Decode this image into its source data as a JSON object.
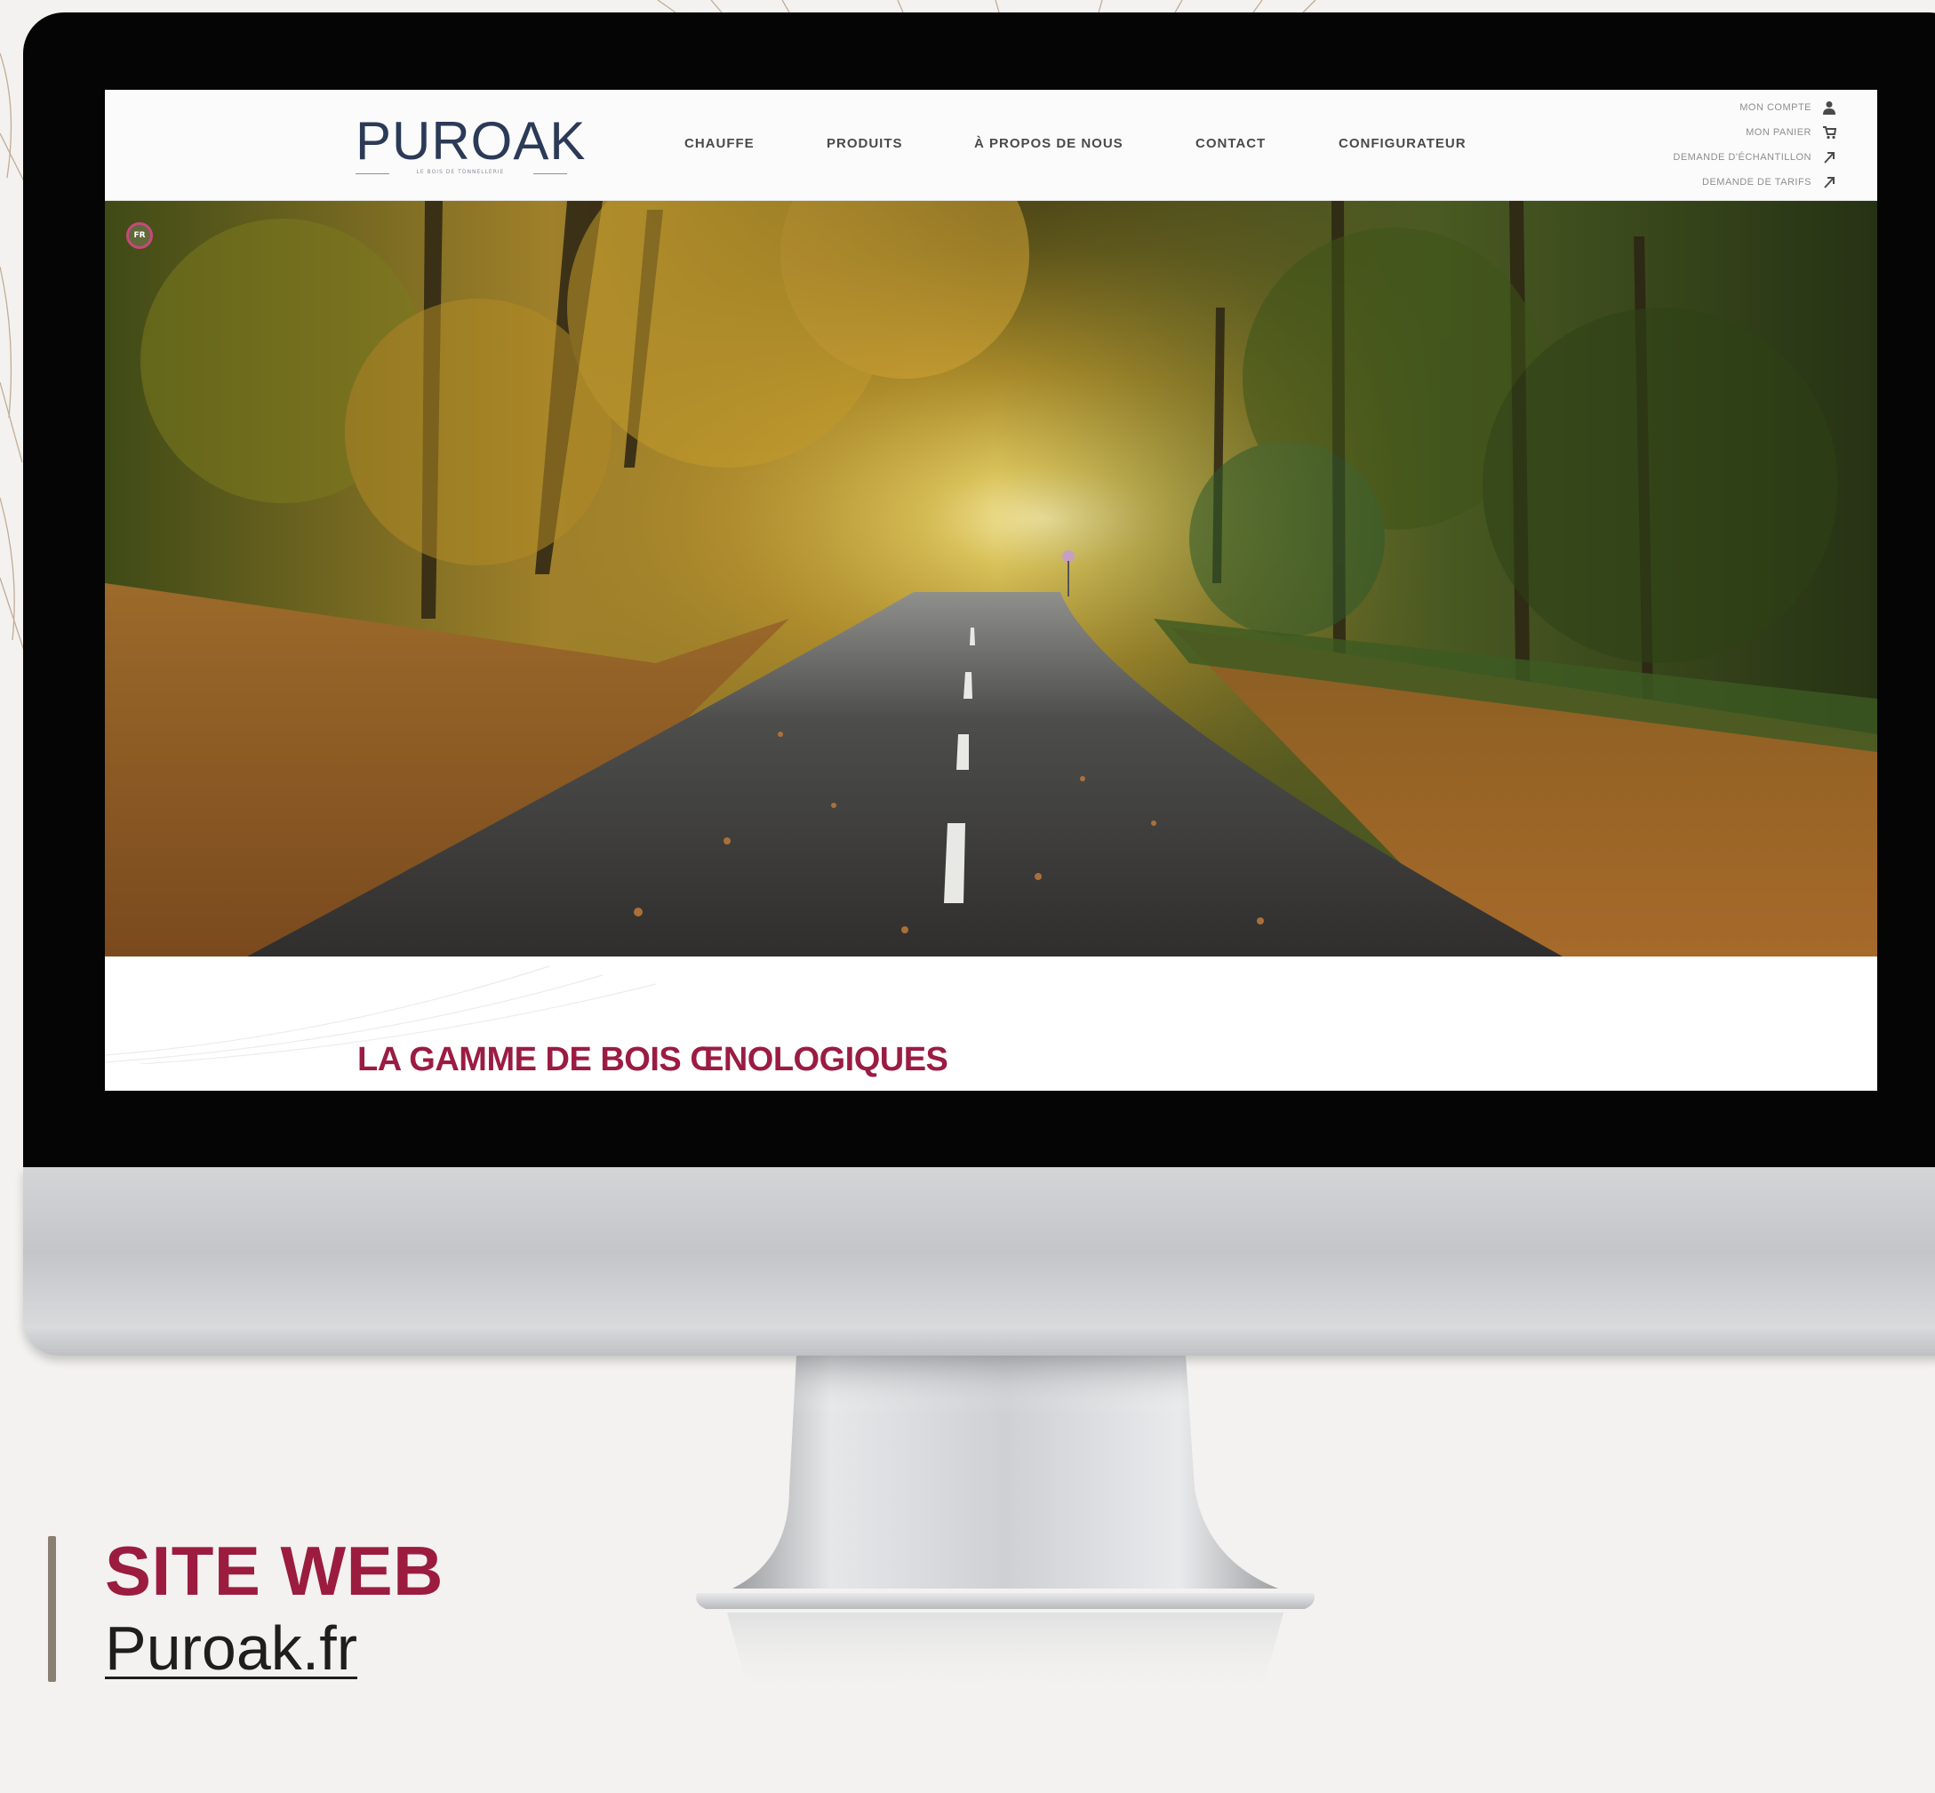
{
  "site": {
    "logo_text": "PUROAK",
    "logo_tagline": "LE BOIS DE TONNELLERIE",
    "nav": [
      {
        "label": "CHAUFFE"
      },
      {
        "label": "PRODUITS"
      },
      {
        "label": "À PROPOS DE NOUS"
      },
      {
        "label": "CONTACT"
      },
      {
        "label": "CONFIGURATEUR"
      }
    ],
    "utility": [
      {
        "label": "MON COMPTE",
        "icon": "user-icon"
      },
      {
        "label": "MON PANIER",
        "icon": "cart-icon"
      },
      {
        "label": "DEMANDE D'ÉCHANTILLON",
        "icon": "arrow-icon"
      },
      {
        "label": "DEMANDE DE TARIFS",
        "icon": "arrow-icon"
      }
    ],
    "lang": "FR",
    "hero_image": "autumn forest road",
    "section_title": "LA GAMME DE BOIS ŒNOLOGIQUES"
  },
  "caption": {
    "title": "SITE WEB",
    "link": "Puroak.fr"
  },
  "colors": {
    "brand": "#9b1c3f",
    "logo_navy": "#2b3a57",
    "lang_badge": "#c44a7a",
    "page_bg": "#f3f2f0"
  }
}
